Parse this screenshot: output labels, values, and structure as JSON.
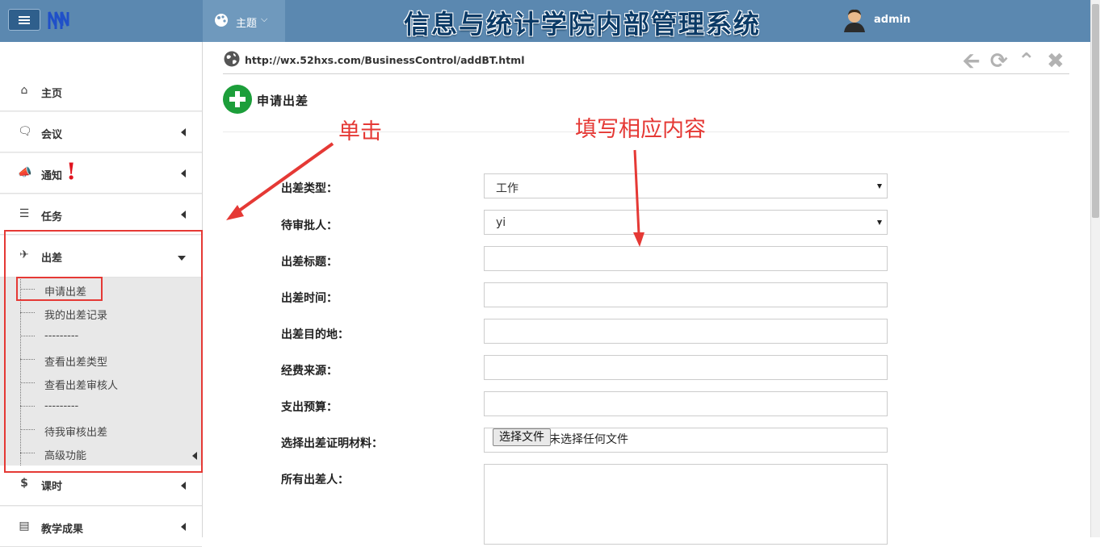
{
  "header": {
    "menu_icon": "hamburger-icon",
    "logo_icon": "nn-logo-icon",
    "theme_label": "主题",
    "system_title": "信息与统计学院内部管理系统",
    "username": "admin"
  },
  "address": {
    "url": "http://wx.52hxs.com/BusinessControl/addBT.html",
    "tools": [
      "arrow-left-icon",
      "refresh-icon",
      "chevron-up-icon",
      "close-icon"
    ]
  },
  "sidebar": {
    "items": [
      {
        "label": "主页",
        "icon": "home-icon"
      },
      {
        "label": "会议",
        "icon": "chat-icon"
      },
      {
        "label": "通知",
        "icon": "megaphone-icon",
        "badge": "!"
      },
      {
        "label": "任务",
        "icon": "tasks-icon"
      },
      {
        "label": "出差",
        "icon": "plane-icon"
      },
      {
        "label": "课时",
        "icon": "dollar-icon"
      },
      {
        "label": "教学成果",
        "icon": "bar-chart-icon"
      }
    ],
    "submenu": [
      "申请出差",
      "我的出差记录",
      "---------",
      "查看出差类型",
      "查看出差审核人",
      "---------",
      "待我审核出差",
      "高级功能"
    ]
  },
  "page": {
    "heading": "申请出差"
  },
  "form": {
    "fields": [
      {
        "label": "出差类型：",
        "value": "工作"
      },
      {
        "label": "待审批人：",
        "value": "yi"
      },
      {
        "label": "出差标题：",
        "value": ""
      },
      {
        "label": "出差时间：",
        "value": ""
      },
      {
        "label": "出差目的地：",
        "value": ""
      },
      {
        "label": "经费来源：",
        "value": ""
      },
      {
        "label": "支出预算：",
        "value": ""
      },
      {
        "label": "选择出差证明材料：",
        "button": "选择文件",
        "file_status": "未选择任何文件"
      },
      {
        "label": "所有出差人：",
        "value": ""
      }
    ]
  },
  "annotations": {
    "click_note": "单击",
    "fill_note": "填写相应内容",
    "color": "#e53935"
  }
}
